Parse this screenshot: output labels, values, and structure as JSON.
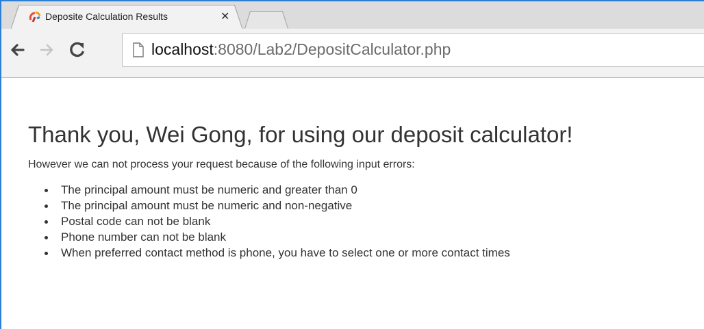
{
  "browser": {
    "tab_title": "Deposite Calculation Results",
    "url_host": "localhost",
    "url_rest": ":8080/Lab2/DepositCalculator.php",
    "icons": {
      "favicon": "app-favicon",
      "close": "close-icon",
      "back": "back-arrow-icon",
      "forward": "forward-arrow-icon",
      "reload": "reload-icon",
      "page": "page-icon"
    }
  },
  "page": {
    "heading": "Thank you, Wei Gong, for using our deposit calculator!",
    "intro": "However we can not process your request because of the following input errors:",
    "errors": [
      "The principal amount must be numeric and greater than 0",
      "The principal amount must be numeric and non-negative",
      "Postal code can not be blank",
      "Phone number can not be blank",
      "When preferred contact method is phone, you have to select one or more contact times"
    ]
  },
  "colors": {
    "window_border": "#2b7fd4",
    "text": "#333333"
  }
}
